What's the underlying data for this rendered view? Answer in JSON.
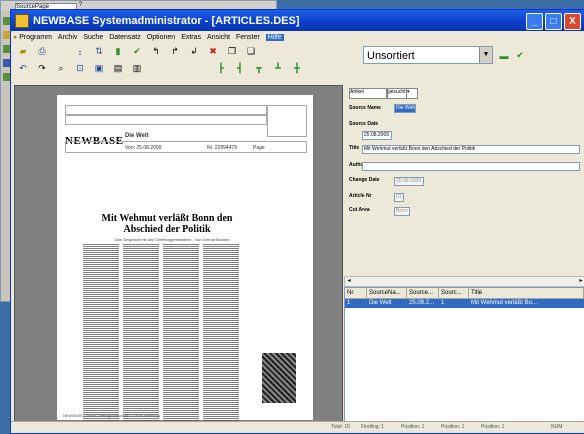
{
  "background_window": {
    "source_label": "SourcePage",
    "tab_label": "?"
  },
  "window": {
    "title": "NEWBASE Systemadministrator - [ARTICLES.DES]",
    "controls": {
      "minimize": "_",
      "maximize": "□",
      "close": "X"
    }
  },
  "menu": [
    {
      "label": "Programm"
    },
    {
      "label": "Archiv"
    },
    {
      "label": "Suche"
    },
    {
      "label": "Datensatz"
    },
    {
      "label": "Optionen"
    },
    {
      "label": "Extras"
    },
    {
      "label": "Ansicht"
    },
    {
      "label": "Fenster"
    },
    {
      "label": "Hilfe"
    }
  ],
  "sort_select": {
    "value": "Unsortiert"
  },
  "document": {
    "logo": "NEWBASE",
    "publication": "Die Welt",
    "date_line": "Von: 25.08.2009",
    "number": "Nr. 22894479",
    "page": "Page",
    "headline": "Mit Wehmut verläßt Bonn den Abschied der Politik",
    "subline": "Das Gespräch mit den Oberbürgermeistern  -  Von Gernot Moeser",
    "footer": "NEWBASE GmbH Datengesellschaft © 2009 Hamburg"
  },
  "properties": {
    "top_chips": [
      "Artikel",
      "gesucht",
      "▾"
    ],
    "fields": [
      {
        "label": "Source Name",
        "value": "Die Welt"
      },
      {
        "label": "Source Date",
        "value": "25.08.2009"
      },
      {
        "label": "Title",
        "value": "Mit Wehmut verläßt Bonn den Abschied der Politik"
      },
      {
        "label": "Author",
        "value": ""
      },
      {
        "label": "Change Date",
        "value": "25.09.2009"
      },
      {
        "label": "Article Nr",
        "value": "01"
      },
      {
        "label": "Cut Area",
        "value": "Bonn"
      }
    ]
  },
  "list": {
    "columns": [
      "Nr.",
      "SourceNa...",
      "Source...",
      "Sourc...",
      "Title"
    ],
    "rows": [
      [
        "1",
        "Die Welt",
        "25.08.2...",
        "1",
        "Mit Wehmut verläßt Bo..."
      ]
    ]
  },
  "status": {
    "items": [
      "Total: 15",
      "Findling: 1",
      "Position: 1",
      "Position: 1",
      "Position: 1",
      "NUM"
    ]
  }
}
